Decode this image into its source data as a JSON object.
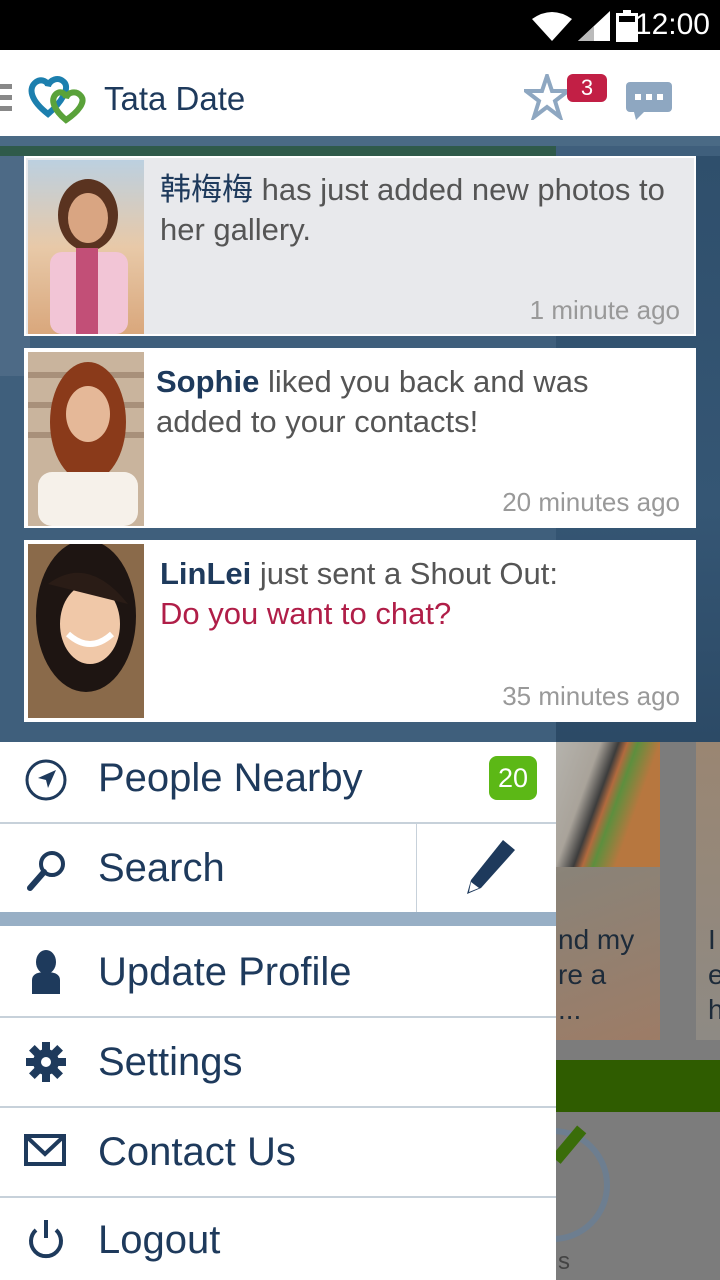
{
  "status_bar": {
    "time": "12:00"
  },
  "app_bar": {
    "title": "Tata Date",
    "favorites_badge": "3",
    "icons": [
      "menu-icon",
      "logo-hearts-icon",
      "star-icon",
      "chat-bubble-icon"
    ]
  },
  "notifications": [
    {
      "name": "韩梅梅",
      "name_bold": false,
      "text": " has just added new photos to her gallery.",
      "shout": "",
      "time": "1 minute ago",
      "unread": true
    },
    {
      "name": "Sophie",
      "name_bold": true,
      "text": " liked you back and was added to your contacts!",
      "shout": "",
      "time": "20 minutes ago",
      "unread": false
    },
    {
      "name": "LinLei",
      "name_bold": true,
      "text": " just sent a Shout Out:",
      "shout": "Do you want to chat?",
      "time": "35 minutes ago",
      "unread": false
    }
  ],
  "menu": {
    "people_nearby": {
      "label": "People Nearby",
      "badge": "20",
      "icon": "navigation-arrow-icon"
    },
    "search": {
      "label": "Search",
      "icon": "search-icon",
      "edit_icon": "pencil-icon"
    },
    "items": [
      {
        "label": "Update Profile",
        "icon": "person-icon"
      },
      {
        "label": "Settings",
        "icon": "gear-icon"
      },
      {
        "label": "Contact Us",
        "icon": "envelope-icon"
      },
      {
        "label": "Logout",
        "icon": "power-icon"
      }
    ]
  },
  "background": {
    "card_text_1": "nd my\nre a\n...",
    "card_text_2": "I\ne\nh",
    "bottom_label": "s"
  },
  "colors": {
    "brand_navy": "#1e3a5c",
    "badge_red": "#c21f45",
    "badge_green": "#5cb816",
    "shout_red": "#b01e48",
    "icon_blue_grey": "#8ea7c1"
  }
}
